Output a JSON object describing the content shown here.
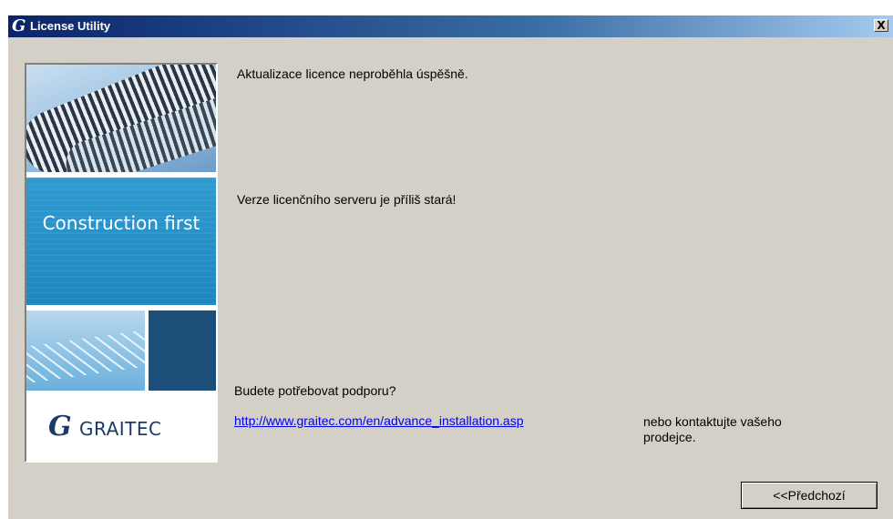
{
  "window": {
    "title": "License Utility",
    "title_logo": "G",
    "close_label": "X"
  },
  "banner": {
    "slogan": "Construction first",
    "logo_mark": "G",
    "logo_text": "GRAITEC"
  },
  "messages": {
    "status": "Aktualizace licence neproběhla úspěšně.",
    "detail": "Verze licenčního serveru je příliš stará!",
    "support_question": "Budete potřebovat podporu?",
    "support_link": "http://www.graitec.com/en/advance_installation.asp",
    "support_contact_line1": "nebo kontaktujte vašeho",
    "support_contact_line2": "prodejce."
  },
  "buttons": {
    "previous": "<<Předchozí"
  }
}
